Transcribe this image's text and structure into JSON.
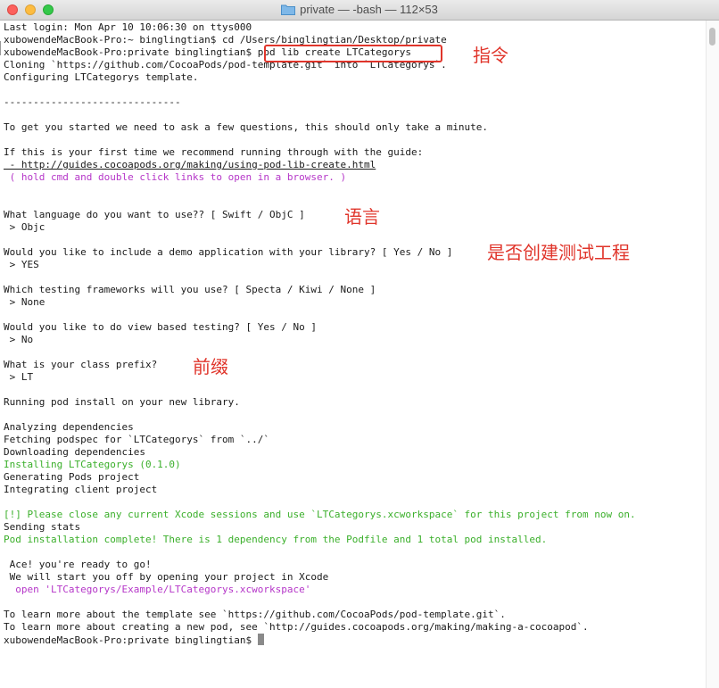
{
  "window": {
    "title": "private — -bash — 112×53"
  },
  "lines": [
    {
      "text": "Last login: Mon Apr 10 10:06:30 on ttys000"
    },
    {
      "text": "xubowendeMacBook-Pro:~ binglingtian$ cd /Users/binglingtian/Desktop/private"
    },
    {
      "text": "xubowendeMacBook-Pro:private binglingtian$ pod lib create LTCategorys"
    },
    {
      "text": "Cloning `https://github.com/CocoaPods/pod-template.git` into `LTCategorys`."
    },
    {
      "text": "Configuring LTCategorys template."
    },
    {
      "text": ""
    },
    {
      "text": "------------------------------"
    },
    {
      "text": ""
    },
    {
      "text": "To get you started we need to ask a few questions, this should only take a minute."
    },
    {
      "text": ""
    },
    {
      "text": "If this is your first time we recommend running through with the guide:"
    },
    {
      "text": " - http://guides.cocoapods.org/making/using-pod-lib-create.html"
    },
    {
      "text": " ( hold cmd and double click links to open in a browser. )"
    },
    {
      "text": ""
    },
    {
      "text": ""
    },
    {
      "text": "What language do you want to use?? [ Swift / ObjC ]"
    },
    {
      "text": " > Objc"
    },
    {
      "text": ""
    },
    {
      "text": "Would you like to include a demo application with your library? [ Yes / No ]"
    },
    {
      "text": " > YES"
    },
    {
      "text": ""
    },
    {
      "text": "Which testing frameworks will you use? [ Specta / Kiwi / None ]"
    },
    {
      "text": " > None"
    },
    {
      "text": ""
    },
    {
      "text": "Would you like to do view based testing? [ Yes / No ]"
    },
    {
      "text": " > No"
    },
    {
      "text": ""
    },
    {
      "text": "What is your class prefix?"
    },
    {
      "text": " > LT"
    },
    {
      "text": ""
    },
    {
      "text": "Running pod install on your new library."
    },
    {
      "text": ""
    },
    {
      "text": "Analyzing dependencies"
    },
    {
      "text": "Fetching podspec for `LTCategorys` from `../`"
    },
    {
      "text": "Downloading dependencies"
    },
    {
      "text": "Installing LTCategorys (0.1.0)"
    },
    {
      "text": "Generating Pods project"
    },
    {
      "text": "Integrating client project"
    },
    {
      "text": ""
    },
    {
      "text": "[!] Please close any current Xcode sessions and use `LTCategorys.xcworkspace` for this project from now on."
    },
    {
      "text": "Sending stats"
    },
    {
      "text": "Pod installation complete! There is 1 dependency from the Podfile and 1 total pod installed."
    },
    {
      "text": ""
    },
    {
      "text": " Ace! you're ready to go!"
    },
    {
      "text": " We will start you off by opening your project in Xcode"
    },
    {
      "text": "  open 'LTCategorys/Example/LTCategorys.xcworkspace'"
    },
    {
      "text": ""
    },
    {
      "text": "To learn more about the template see `https://github.com/CocoaPods/pod-template.git`."
    },
    {
      "text": "To learn more about creating a new pod, see `http://guides.cocoapods.org/making/making-a-cocoapod`."
    },
    {
      "text": "xubowendeMacBook-Pro:private binglingtian$ "
    }
  ],
  "annotations": {
    "command": "指令",
    "language": "语言",
    "demo": "是否创建测试工程",
    "prefix": "前缀"
  },
  "colors": {
    "annotation": "#e0352b",
    "green_output": "#3aaf2a",
    "magenta_output": "#b536c8"
  }
}
